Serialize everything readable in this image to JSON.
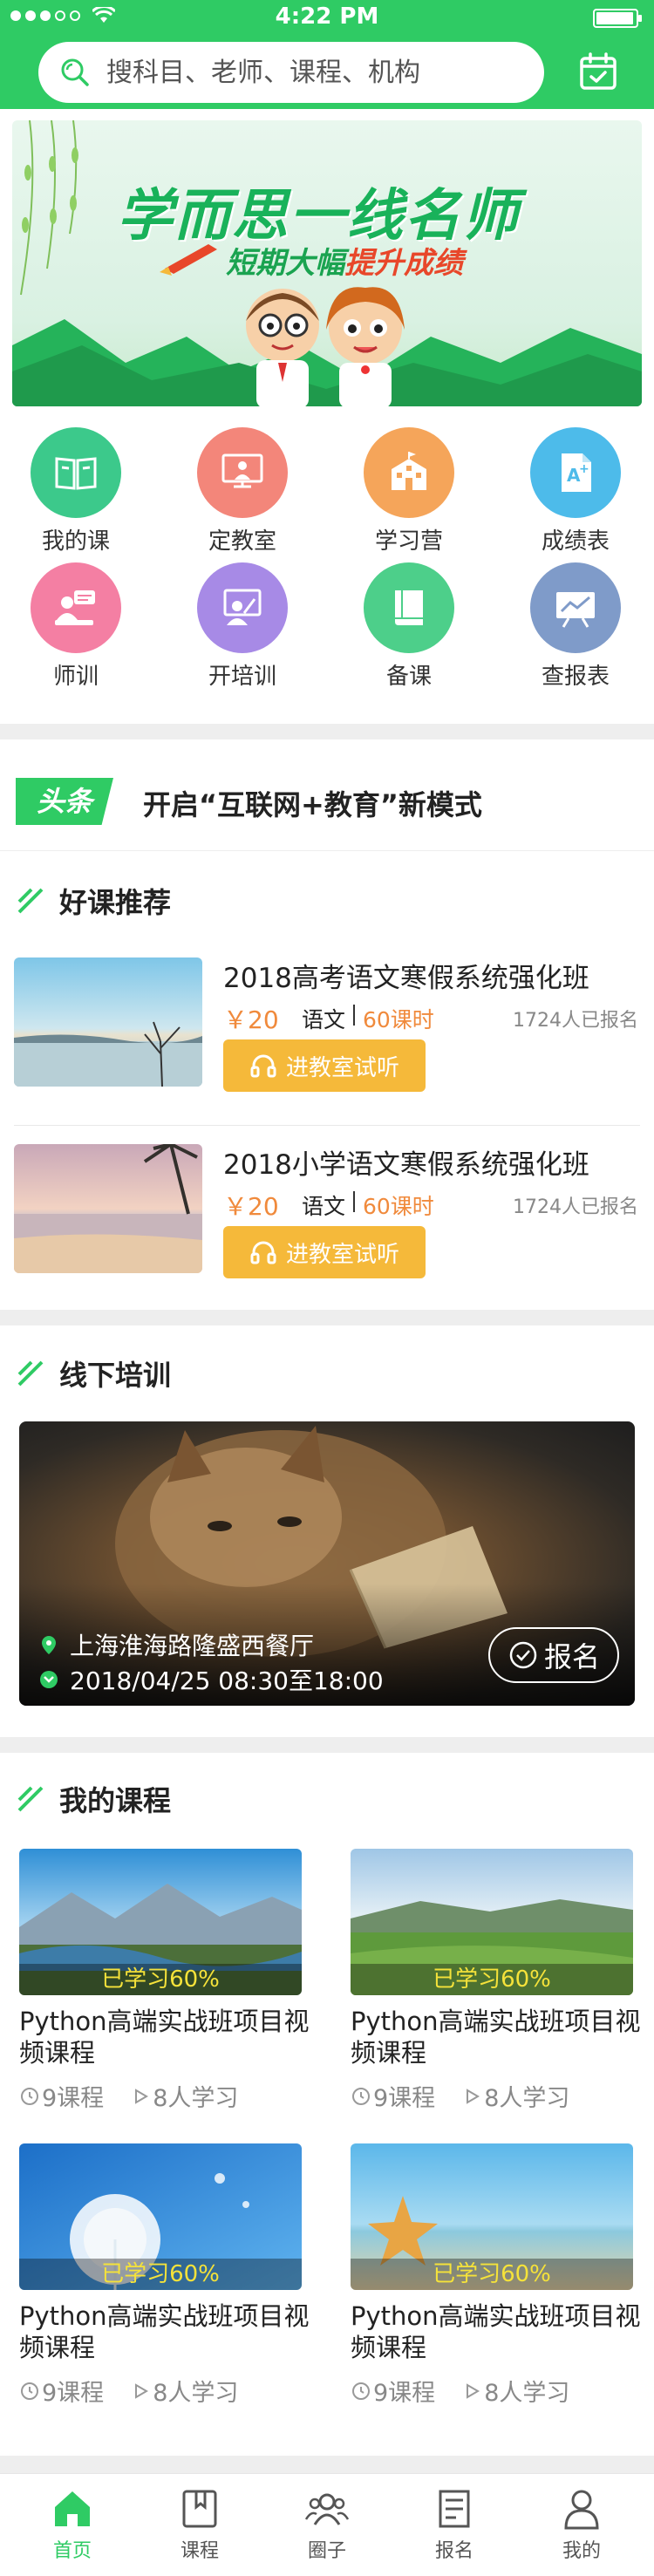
{
  "status_bar": {
    "time": "4:22 PM"
  },
  "search": {
    "placeholder": "搜科目、老师、课程、机构"
  },
  "banner": {
    "title": "学而思一线名师",
    "subtitle_prefix": "短期大幅",
    "subtitle_highlight": "提升成绩"
  },
  "grid": [
    {
      "label": "我的课",
      "icon": "open-book-icon",
      "color": "#3cc98b"
    },
    {
      "label": "定教室",
      "icon": "classroom-icon",
      "color": "#f3867a"
    },
    {
      "label": "学习营",
      "icon": "school-building-icon",
      "color": "#f5a55a"
    },
    {
      "label": "成绩表",
      "icon": "grade-sheet-icon",
      "color": "#4dbbea"
    },
    {
      "label": "师训",
      "icon": "teacher-training-icon",
      "color": "#f47fa3"
    },
    {
      "label": "开培训",
      "icon": "trainer-icon",
      "color": "#a78ae6"
    },
    {
      "label": "备课",
      "icon": "lesson-book-icon",
      "color": "#4dcf8a"
    },
    {
      "label": "查报表",
      "icon": "report-chart-icon",
      "color": "#7f9bc9"
    }
  ],
  "headline": {
    "badge": "头条",
    "text": "开启“互联网+教育”新模式"
  },
  "sections": {
    "recommend": "好课推荐",
    "offline": "线下培训",
    "my_courses": "我的课程"
  },
  "recommend_courses": [
    {
      "title": "2018高考语文寒假系统强化班",
      "price": "￥20",
      "subject": "语文",
      "hours": "60课时",
      "enrolled": "1724人已报名",
      "button": "进教室试听"
    },
    {
      "title": "2018小学语文寒假系统强化班",
      "price": "￥20",
      "subject": "语文",
      "hours": "60课时",
      "enrolled": "1724人已报名",
      "button": "进教室试听"
    }
  ],
  "offline": {
    "location": "上海淮海路隆盛西餐厅",
    "datetime": "2018/04/25 08:30至18:00",
    "button": "报名"
  },
  "my_courses": [
    {
      "progress": "已学习60%",
      "name": "Python高端实战班项目视频课程",
      "lessons": "9课程",
      "learners": "8人学习"
    },
    {
      "progress": "已学习60%",
      "name": "Python高端实战班项目视频课程",
      "lessons": "9课程",
      "learners": "8人学习"
    },
    {
      "progress": "已学习60%",
      "name": "Python高端实战班项目视频课程",
      "lessons": "9课程",
      "learners": "8人学习"
    },
    {
      "progress": "已学习60%",
      "name": "Python高端实战班项目视频课程",
      "lessons": "9课程",
      "learners": "8人学习"
    }
  ],
  "tabbar": [
    {
      "label": "首页",
      "icon": "home-icon",
      "active": true
    },
    {
      "label": "课程",
      "icon": "bookmark-book-icon",
      "active": false
    },
    {
      "label": "圈子",
      "icon": "group-icon",
      "active": false
    },
    {
      "label": "报名",
      "icon": "signup-form-icon",
      "active": false
    },
    {
      "label": "我的",
      "icon": "profile-icon",
      "active": false
    }
  ],
  "colors": {
    "primary": "#2fcb64",
    "price": "#f08a3c",
    "button": "#f5b93a",
    "progress_text": "#f5e23a"
  }
}
